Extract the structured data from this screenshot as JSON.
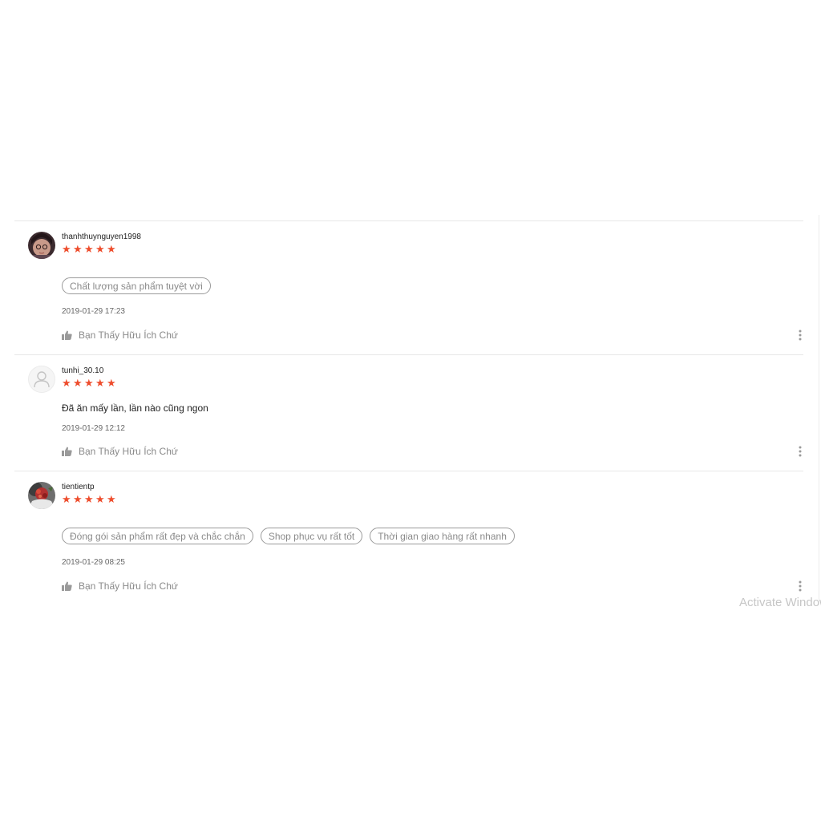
{
  "reviews": [
    {
      "username": "thanhthuynguyen1998",
      "rating": 5,
      "tags": [
        "Chất lượng sản phẩm tuyệt vời"
      ],
      "timestamp": "2019-01-29 17:23",
      "helpful_label": "Bạn Thấy Hữu Ích Chứ"
    },
    {
      "username": "tunhi_30.10",
      "rating": 5,
      "comment": "Đã ăn mấy lần, lần nào cũng ngon",
      "timestamp": "2019-01-29 12:12",
      "helpful_label": "Bạn Thấy Hữu Ích Chứ"
    },
    {
      "username": "tientientp",
      "rating": 5,
      "tags": [
        "Đóng gói sản phẩm rất đẹp và chắc chắn",
        "Shop phục vụ rất tốt",
        "Thời gian giao hàng rất nhanh"
      ],
      "timestamp": "2019-01-29 08:25",
      "helpful_label": "Bạn Thấy Hữu Ích Chứ"
    }
  ],
  "watermark": "Activate Windows",
  "colors": {
    "star": "#ee4d2d",
    "tag_border": "#9a9a9a",
    "muted_text": "#8a8a8a",
    "divider": "#e8e8e8"
  },
  "icons": {
    "star": "star-icon",
    "like": "thumbs-up-icon",
    "more": "more-vertical-icon",
    "placeholder_avatar": "user-icon"
  }
}
